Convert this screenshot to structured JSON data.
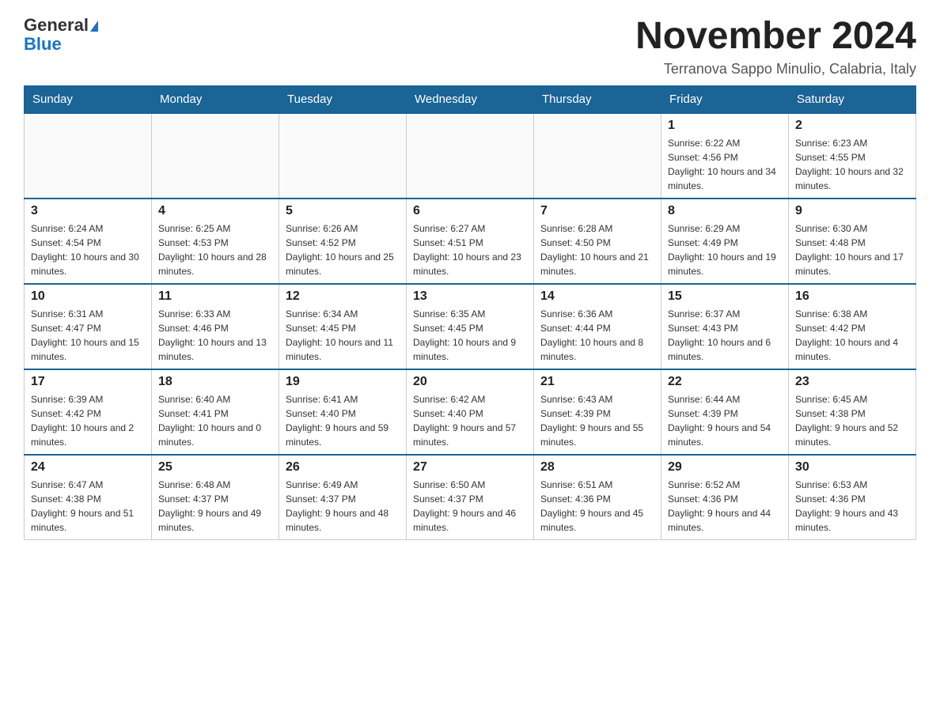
{
  "header": {
    "logo_general": "General",
    "logo_blue": "Blue",
    "month_title": "November 2024",
    "location": "Terranova Sappo Minulio, Calabria, Italy"
  },
  "weekdays": [
    "Sunday",
    "Monday",
    "Tuesday",
    "Wednesday",
    "Thursday",
    "Friday",
    "Saturday"
  ],
  "weeks": [
    [
      {
        "day": "",
        "info": ""
      },
      {
        "day": "",
        "info": ""
      },
      {
        "day": "",
        "info": ""
      },
      {
        "day": "",
        "info": ""
      },
      {
        "day": "",
        "info": ""
      },
      {
        "day": "1",
        "info": "Sunrise: 6:22 AM\nSunset: 4:56 PM\nDaylight: 10 hours and 34 minutes."
      },
      {
        "day": "2",
        "info": "Sunrise: 6:23 AM\nSunset: 4:55 PM\nDaylight: 10 hours and 32 minutes."
      }
    ],
    [
      {
        "day": "3",
        "info": "Sunrise: 6:24 AM\nSunset: 4:54 PM\nDaylight: 10 hours and 30 minutes."
      },
      {
        "day": "4",
        "info": "Sunrise: 6:25 AM\nSunset: 4:53 PM\nDaylight: 10 hours and 28 minutes."
      },
      {
        "day": "5",
        "info": "Sunrise: 6:26 AM\nSunset: 4:52 PM\nDaylight: 10 hours and 25 minutes."
      },
      {
        "day": "6",
        "info": "Sunrise: 6:27 AM\nSunset: 4:51 PM\nDaylight: 10 hours and 23 minutes."
      },
      {
        "day": "7",
        "info": "Sunrise: 6:28 AM\nSunset: 4:50 PM\nDaylight: 10 hours and 21 minutes."
      },
      {
        "day": "8",
        "info": "Sunrise: 6:29 AM\nSunset: 4:49 PM\nDaylight: 10 hours and 19 minutes."
      },
      {
        "day": "9",
        "info": "Sunrise: 6:30 AM\nSunset: 4:48 PM\nDaylight: 10 hours and 17 minutes."
      }
    ],
    [
      {
        "day": "10",
        "info": "Sunrise: 6:31 AM\nSunset: 4:47 PM\nDaylight: 10 hours and 15 minutes."
      },
      {
        "day": "11",
        "info": "Sunrise: 6:33 AM\nSunset: 4:46 PM\nDaylight: 10 hours and 13 minutes."
      },
      {
        "day": "12",
        "info": "Sunrise: 6:34 AM\nSunset: 4:45 PM\nDaylight: 10 hours and 11 minutes."
      },
      {
        "day": "13",
        "info": "Sunrise: 6:35 AM\nSunset: 4:45 PM\nDaylight: 10 hours and 9 minutes."
      },
      {
        "day": "14",
        "info": "Sunrise: 6:36 AM\nSunset: 4:44 PM\nDaylight: 10 hours and 8 minutes."
      },
      {
        "day": "15",
        "info": "Sunrise: 6:37 AM\nSunset: 4:43 PM\nDaylight: 10 hours and 6 minutes."
      },
      {
        "day": "16",
        "info": "Sunrise: 6:38 AM\nSunset: 4:42 PM\nDaylight: 10 hours and 4 minutes."
      }
    ],
    [
      {
        "day": "17",
        "info": "Sunrise: 6:39 AM\nSunset: 4:42 PM\nDaylight: 10 hours and 2 minutes."
      },
      {
        "day": "18",
        "info": "Sunrise: 6:40 AM\nSunset: 4:41 PM\nDaylight: 10 hours and 0 minutes."
      },
      {
        "day": "19",
        "info": "Sunrise: 6:41 AM\nSunset: 4:40 PM\nDaylight: 9 hours and 59 minutes."
      },
      {
        "day": "20",
        "info": "Sunrise: 6:42 AM\nSunset: 4:40 PM\nDaylight: 9 hours and 57 minutes."
      },
      {
        "day": "21",
        "info": "Sunrise: 6:43 AM\nSunset: 4:39 PM\nDaylight: 9 hours and 55 minutes."
      },
      {
        "day": "22",
        "info": "Sunrise: 6:44 AM\nSunset: 4:39 PM\nDaylight: 9 hours and 54 minutes."
      },
      {
        "day": "23",
        "info": "Sunrise: 6:45 AM\nSunset: 4:38 PM\nDaylight: 9 hours and 52 minutes."
      }
    ],
    [
      {
        "day": "24",
        "info": "Sunrise: 6:47 AM\nSunset: 4:38 PM\nDaylight: 9 hours and 51 minutes."
      },
      {
        "day": "25",
        "info": "Sunrise: 6:48 AM\nSunset: 4:37 PM\nDaylight: 9 hours and 49 minutes."
      },
      {
        "day": "26",
        "info": "Sunrise: 6:49 AM\nSunset: 4:37 PM\nDaylight: 9 hours and 48 minutes."
      },
      {
        "day": "27",
        "info": "Sunrise: 6:50 AM\nSunset: 4:37 PM\nDaylight: 9 hours and 46 minutes."
      },
      {
        "day": "28",
        "info": "Sunrise: 6:51 AM\nSunset: 4:36 PM\nDaylight: 9 hours and 45 minutes."
      },
      {
        "day": "29",
        "info": "Sunrise: 6:52 AM\nSunset: 4:36 PM\nDaylight: 9 hours and 44 minutes."
      },
      {
        "day": "30",
        "info": "Sunrise: 6:53 AM\nSunset: 4:36 PM\nDaylight: 9 hours and 43 minutes."
      }
    ]
  ]
}
